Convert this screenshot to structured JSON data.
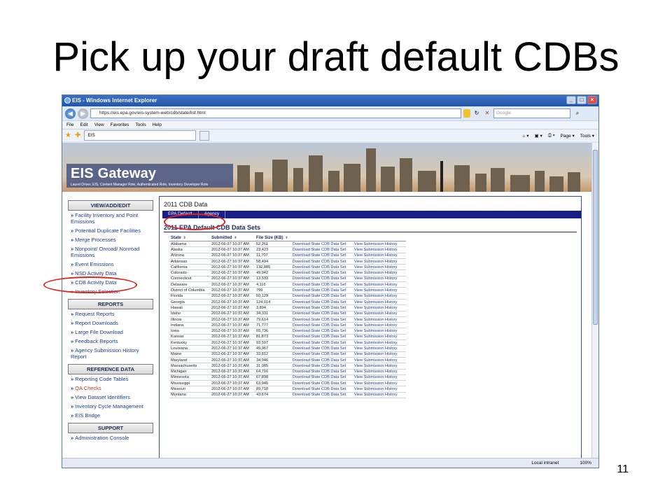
{
  "slide": {
    "title": "Pick up your draft default CDBs",
    "number": "11"
  },
  "browser": {
    "window_title": "EIS - Windows Internet Explorer",
    "url": "https://eis.epa.gov/eis-system-web/cdb/state/list.html",
    "search_placeholder": "Google",
    "menu": [
      "File",
      "Edit",
      "View",
      "Favorites",
      "Tools",
      "Help"
    ],
    "tab_label": "EIS",
    "command_bar": [
      "Page ▾",
      "Tools ▾"
    ],
    "status": {
      "zone": "Local intranet",
      "zoom": "100%"
    }
  },
  "site": {
    "banner_title": "EIS Gateway",
    "banner_subtitle": "Laurel Driver, EIS, Content Manager Role, Authenticated Role, Inventory Developer Role"
  },
  "sidebar": {
    "sections": [
      {
        "title": "VIEW/ADD/EDIT",
        "items": [
          "Facility Inventory and Point Emissions",
          "Potential Duplicate Facilities",
          "Merge Processes",
          "Nonpoint/ Onroad/ Nonroad Emissions",
          "Event Emissions",
          "NSD Activity Data",
          "CDB Activity Data",
          "Inventory Selection"
        ]
      },
      {
        "title": "REPORTS",
        "items": [
          "Request Reports",
          "Report Downloads",
          "Large File Download",
          "Feedback Reports",
          "Agency Submission History Report"
        ]
      },
      {
        "title": "REFERENCE DATA",
        "items": [
          "Reporting Code Tables",
          "QA Checks",
          "View Dataset Identifiers",
          "Inventory Cycle Management",
          "EIS Bridge"
        ]
      },
      {
        "title": "SUPPORT",
        "items": [
          "Administration Console"
        ]
      }
    ]
  },
  "main": {
    "title": "2011 CDB Data",
    "tabs": [
      "EPA Default",
      "Agency"
    ],
    "dataset_title": "2011 EPA Default CDB Data Sets",
    "columns": [
      "State",
      "Submitted",
      "File Size (KB)"
    ],
    "link_download": "Download State CDB Data Set",
    "link_history": "View Submission History",
    "rows": [
      [
        "Alabama",
        "2012-06-27 10:37 AM",
        "52,261"
      ],
      [
        "Alaska",
        "2012-06-27 10:37 AM",
        "23,423"
      ],
      [
        "Arizona",
        "2012-06-27 10:37 AM",
        "11,707"
      ],
      [
        "Arkansas",
        "2012-06-27 10:37 AM",
        "58,494"
      ],
      [
        "California",
        "2012-06-27 10:37 AM",
        "132,885"
      ],
      [
        "Colorado",
        "2012-06-27 10:37 AM",
        "49,942"
      ],
      [
        "Connecticut",
        "2012-06-27 10:37 AM",
        "13,533"
      ],
      [
        "Delaware",
        "2012-06-27 10:37 AM",
        "4,116"
      ],
      [
        "District of Columbia",
        "2012-06-27 10:37 AM",
        "799"
      ],
      [
        "Florida",
        "2012-06-27 10:37 AM",
        "50,129"
      ],
      [
        "Georgia",
        "2012-06-27 10:37 AM",
        "124,014"
      ],
      [
        "Hawaii",
        "2012-06-27 10:37 AM",
        "3,894"
      ],
      [
        "Idaho",
        "2012-06-27 10:37 AM",
        "34,331"
      ],
      [
        "Illinois",
        "2012-06-27 10:37 AM",
        "79,614"
      ],
      [
        "Indiana",
        "2012-06-27 10:37 AM",
        "71,777"
      ],
      [
        "Iowa",
        "2012-06-27 10:37 AM",
        "65,736"
      ],
      [
        "Kansas",
        "2012-06-27 10:37 AM",
        "81,873"
      ],
      [
        "Kentucky",
        "2012-06-27 10:37 AM",
        "93,597"
      ],
      [
        "Louisiana",
        "2012-06-27 10:37 AM",
        "49,967"
      ],
      [
        "Maine",
        "2012-06-27 10:37 AM",
        "33,812"
      ],
      [
        "Maryland",
        "2012-06-27 10:37 AM",
        "34,946"
      ],
      [
        "Massachusetts",
        "2012-06-27 10:37 AM",
        "31,085"
      ],
      [
        "Michigan",
        "2012-06-27 10:37 AM",
        "64,716"
      ],
      [
        "Minnesota",
        "2012-06-27 10:37 AM",
        "67,898"
      ],
      [
        "Mississippi",
        "2012-06-27 10:37 AM",
        "63,945"
      ],
      [
        "Missouri",
        "2012-06-27 10:37 AM",
        "89,718"
      ],
      [
        "Montana",
        "2012-06-27 10:37 AM",
        "43,674"
      ]
    ]
  },
  "colors": {
    "accent": "#1a1f86",
    "annotation": "#e2231a",
    "link": "#1f3d8c"
  }
}
